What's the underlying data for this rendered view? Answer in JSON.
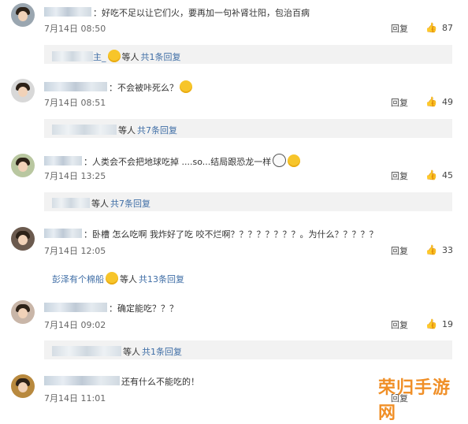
{
  "comments": [
    {
      "text": "：好吃不足以让它们火，要再加一句补肾壮阳，包治百病",
      "date": "7月14日 08:50",
      "reply_label": "回复",
      "likes": "87",
      "avatar_colors": [
        "#9aa6b0",
        "#2d2218"
      ],
      "reply_summary": {
        "name_suffix": "主_",
        "etc": "等人",
        "link": "共1条回复"
      }
    },
    {
      "text": "：不会被咔死么？",
      "date": "7月14日 08:51",
      "reply_label": "回复",
      "likes": "49",
      "avatar_colors": [
        "#d8d8d8",
        "#1e1611"
      ],
      "reply_summary": {
        "name_suffix": "",
        "etc": "等人",
        "link": "共7条回复"
      }
    },
    {
      "text": "：人类会不会把地球吃掉 ....so...结局跟恐龙一样",
      "date": "7月14日 13:25",
      "reply_label": "回复",
      "likes": "45",
      "avatar_colors": [
        "#b9c7a0",
        "#2a2117"
      ],
      "reply_summary": {
        "name_suffix": "",
        "etc": "等人",
        "link": "共7条回复"
      }
    },
    {
      "text": "：卧槽  怎么吃啊  我炸好了吃 咬不烂啊？？？？？？？？。为什么？？？？？",
      "date": "7月14日 12:05",
      "reply_label": "回复",
      "likes": "33",
      "avatar_colors": [
        "#6b5a4e",
        "#1b1410"
      ],
      "reply_summary": {
        "name": "彭泽有个棉船",
        "etc": "等人",
        "link": "共13条回复"
      }
    },
    {
      "text": "：确定能吃？？？",
      "date": "7月14日 09:02",
      "reply_label": "回复",
      "likes": "19",
      "avatar_colors": [
        "#c9b6a8",
        "#3a2a20"
      ],
      "reply_summary": {
        "name_suffix": "",
        "etc": "等人",
        "link": "共1条回复"
      }
    },
    {
      "text": "还有什么不能吃的！",
      "date": "7月14日 11:01",
      "reply_label": "回复",
      "likes": "",
      "avatar_colors": [
        "#b8893e",
        "#5a3a1a"
      ]
    }
  ],
  "watermark": "荣归手游网"
}
